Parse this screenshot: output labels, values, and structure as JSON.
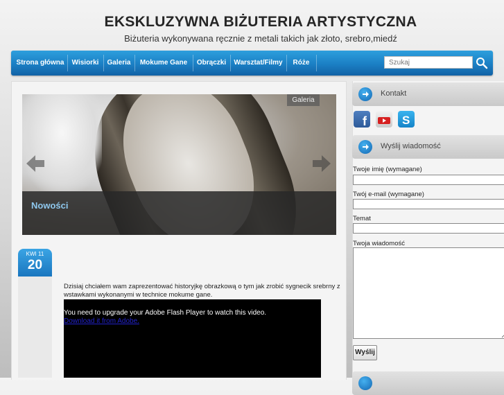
{
  "header": {
    "title": "EKSKLUZYWNA BIŻUTERIA ARTYSTYCZNA",
    "tagline": "Biżuteria wykonywana ręcznie z metali takich jak złoto, srebro,miedź"
  },
  "nav": {
    "items": [
      {
        "label": "Strona główna"
      },
      {
        "label": "Wisiorki"
      },
      {
        "label": "Galeria"
      },
      {
        "label": "Mokume Gane"
      },
      {
        "label": "Obrączki"
      },
      {
        "label": "Warsztat/Filmy"
      },
      {
        "label": "Róże"
      }
    ],
    "search_placeholder": "Szukaj"
  },
  "slider": {
    "tag": "Galeria",
    "caption": "Nowości"
  },
  "post": {
    "date_month": "KWI 11",
    "date_day": "20",
    "text": "Dzisiaj chciałem wam zaprezentować historyjkę  obrazkową o tym jak zrobić sygnecik srebrny z wstawkami wykonanymi w technice mokume gane.",
    "flash_message": "You need to upgrade your Adobe Flash Player to watch this video.",
    "flash_link": "Download it from Adobe."
  },
  "sidebar": {
    "contact_title": "Kontakt",
    "send_title": "Wyślij wiadomość",
    "social": [
      "facebook-icon",
      "youtube-icon",
      "skype-icon"
    ],
    "form": {
      "name_label": "Twoje imię (wymagane)",
      "email_label": "Twój e-mail (wymagane)",
      "subject_label": "Temat",
      "message_label": "Twoja wiadomość",
      "submit_label": "Wyślij"
    }
  },
  "colors": {
    "nav_blue": "#1b7fc4",
    "accent": "#1a76bf",
    "caption_text": "#8fc8ee"
  }
}
